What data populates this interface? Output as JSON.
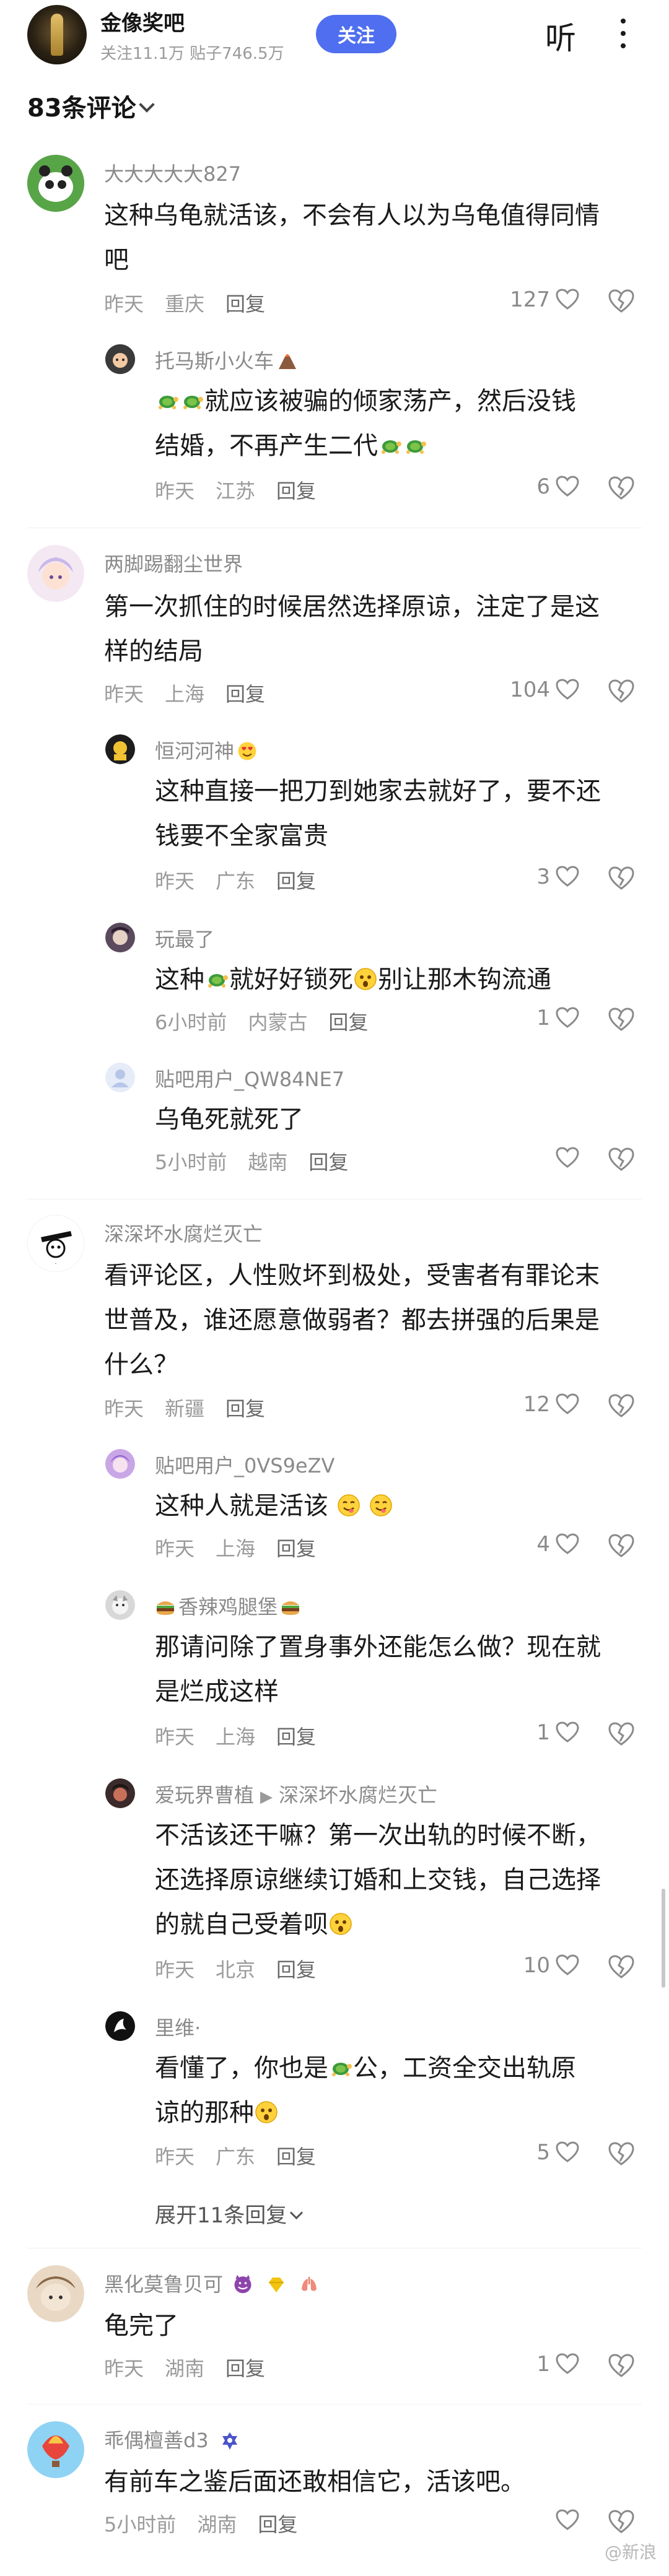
{
  "header": {
    "forum_name": "金像奖吧",
    "forum_stats": "关注11.1万 贴子746.5万",
    "follow_label": "关注",
    "listen_label": "听",
    "comment_count": "83条评论"
  },
  "comments": [
    {
      "user": "大大大大大827",
      "text_lines": [
        "这种乌龟就活该，不会有人以为乌龟值得同情",
        "吧"
      ],
      "time": "昨天",
      "location": "重庆",
      "reply": "回复",
      "likes": "127",
      "replies": [
        {
          "user": "托马斯小火车",
          "text_lines": [
            "就应该被骗的倾家荡产，然后没钱",
            "结婚，不再产生二代"
          ],
          "time": "昨天",
          "location": "江苏",
          "reply": "回复",
          "likes": "6"
        }
      ]
    },
    {
      "user": "两脚踢翻尘世界",
      "text_lines": [
        "第一次抓住的时候居然选择原谅，注定了是这",
        "样的结局"
      ],
      "time": "昨天",
      "location": "上海",
      "reply": "回复",
      "likes": "104",
      "replies": [
        {
          "user": "恒河河神",
          "text_lines": [
            "这种直接一把刀到她家去就好了，要不还",
            "钱要不全家富贵"
          ],
          "time": "昨天",
          "location": "广东",
          "reply": "回复",
          "likes": "3"
        },
        {
          "user": "玩最了",
          "text_lines": [
            "这种",
            "就好好锁死",
            "别让那木钩流通"
          ],
          "time": "6小时前",
          "location": "内蒙古",
          "reply": "回复",
          "likes": "1"
        },
        {
          "user": "贴吧用户_QW84NE7",
          "text_lines": [
            "乌龟死就死了"
          ],
          "time": "5小时前",
          "location": "越南",
          "reply": "回复",
          "likes": ""
        }
      ]
    },
    {
      "user": "深深坏水腐烂灭亡",
      "text_lines": [
        "看评论区，人性败坏到极处，受害者有罪论末",
        "世普及，谁还愿意做弱者？都去拼强的后果是",
        "什么？"
      ],
      "time": "昨天",
      "location": "新疆",
      "reply": "回复",
      "likes": "12",
      "replies": [
        {
          "user": "贴吧用户_0VS9eZV",
          "text_lines": [
            "这种人就是活该"
          ],
          "time": "昨天",
          "location": "上海",
          "reply": "回复",
          "likes": "4"
        },
        {
          "user": "香辣鸡腿堡",
          "text_lines": [
            "那请问除了置身事外还能怎么做？现在就",
            "是烂成这样"
          ],
          "time": "昨天",
          "location": "上海",
          "reply": "回复",
          "likes": "1"
        },
        {
          "user": "爱玩界曹植",
          "reply_to": "深深坏水腐烂灭亡",
          "text_lines": [
            "不活该还干嘛？第一次出轨的时候不断，",
            "还选择原谅继续订婚和上交钱，自己选择",
            "的就自己受着呗"
          ],
          "time": "昨天",
          "location": "北京",
          "reply": "回复",
          "likes": "10"
        },
        {
          "user": "里维·",
          "text_lines": [
            "看懂了，你也是",
            "公，工资全交出轨原",
            "谅的那种"
          ],
          "time": "昨天",
          "location": "广东",
          "reply": "回复",
          "likes": "5"
        }
      ],
      "expand_label": "展开11条回复"
    },
    {
      "user": "黑化莫鲁贝可",
      "text_lines": [
        "龟完了"
      ],
      "time": "昨天",
      "location": "湖南",
      "reply": "回复",
      "likes": "1",
      "replies": []
    },
    {
      "user": "乖偶檀善d3",
      "text_lines": [
        "有前车之鉴后面还敢相信它，活该吧。"
      ],
      "time": "5小时前",
      "location": "湖南",
      "reply": "回复",
      "likes": "",
      "replies": []
    }
  ],
  "watermark": "@新浪"
}
